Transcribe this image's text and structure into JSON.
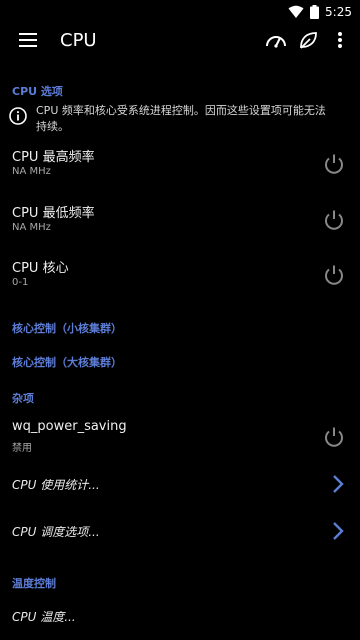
{
  "status": {
    "time": "5:25"
  },
  "toolbar": {
    "title": "CPU"
  },
  "sections": {
    "cpu_options": "CPU 选项",
    "core_little": "核心控制（小核集群）",
    "core_big": "核心控制（大核集群）",
    "misc": "杂项",
    "thermal": "温度控制"
  },
  "info": {
    "text": "CPU 频率和核心受系统进程控制。因而这些设置项可能无法持续。"
  },
  "settings": [
    {
      "label": "CPU 最高频率",
      "sub": "NA MHz"
    },
    {
      "label": "CPU 最低频率",
      "sub": "NA MHz"
    },
    {
      "label": "CPU 核心",
      "sub": "0-1"
    },
    {
      "label": "wq_power_saving",
      "sub": "禁用"
    }
  ],
  "links": [
    {
      "label": "CPU 使用统计..."
    },
    {
      "label": "CPU 调度选项..."
    },
    {
      "label": "CPU 温度..."
    }
  ],
  "colors": {
    "accent": "#5c7cd6",
    "background": "#000000"
  }
}
